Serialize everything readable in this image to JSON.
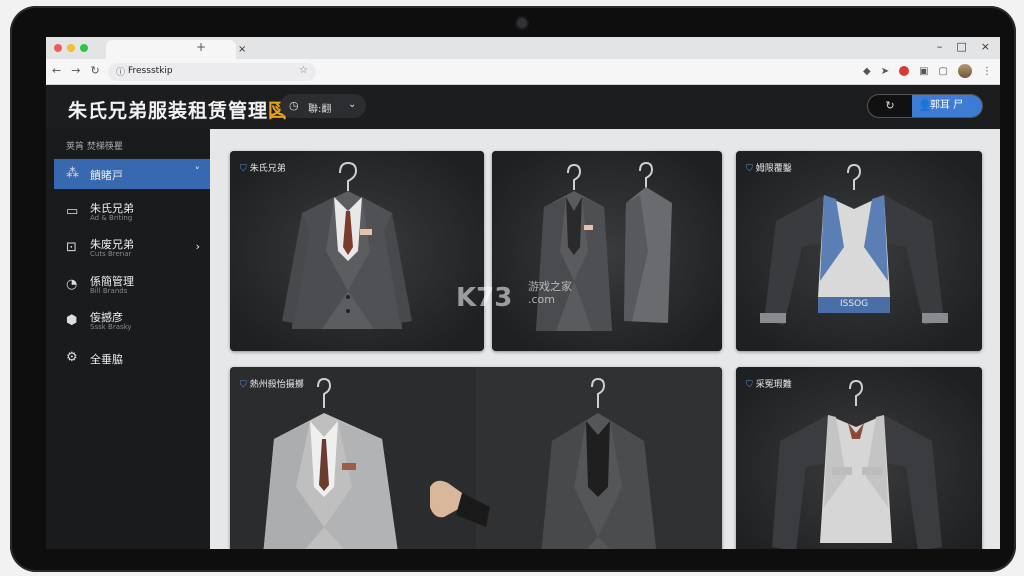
{
  "browser": {
    "url": "Fressstkip",
    "colors": {
      "close": "#ee5f57",
      "min": "#f5bd2f",
      "max": "#2bc840"
    },
    "tab_close": "×",
    "new_tab": "+",
    "win_controls": [
      "–",
      "□",
      "×"
    ],
    "nav": [
      "←",
      "→",
      "↻"
    ]
  },
  "app": {
    "title": "朱氏兄弟服装租赁管理",
    "title_badge": "図",
    "header_pill": {
      "label": "聯:翻",
      "icon": "clock-icon"
    },
    "account_label": "郭耳 尸"
  },
  "sidebar": {
    "breadcrumb": "荚筲   焚梯筷瞿",
    "items": [
      {
        "label": "饋睹戸",
        "sub": "",
        "icon": "hanger-grid-icon",
        "active": true,
        "chevron": "˅"
      },
      {
        "label": "朱氏兄弟",
        "sub": "Ad & Briting",
        "icon": "folder-icon",
        "active": false,
        "chevron": ""
      },
      {
        "label": "朱废兄弟",
        "sub": "Cuts Brenar",
        "icon": "scanner-icon",
        "active": false,
        "chevron": "›"
      },
      {
        "label": "係簡管理",
        "sub": "Bill Brands",
        "icon": "clock-icon",
        "active": false,
        "chevron": ""
      },
      {
        "label": "侫撼彦",
        "sub": "Sssk Brasky",
        "icon": "hexagon-icon",
        "active": false,
        "chevron": ""
      },
      {
        "label": "全垂脇",
        "sub": "",
        "icon": "gear-icon",
        "active": false,
        "chevron": ""
      }
    ]
  },
  "cards": [
    {
      "title": "朱氏兄弟",
      "kind": "suit-grey"
    },
    {
      "title": "",
      "kind": "suit-pair"
    },
    {
      "title": "姆限覆鑿",
      "kind": "vest-blue",
      "band": "ISSOG"
    },
    {
      "title": "熱州殺怡摄擲",
      "kind": "suit-light"
    },
    {
      "title": "采冤瑕難",
      "kind": "vest-grey"
    }
  ],
  "watermark": {
    "brand": "K73",
    "site": "游戏之家",
    "domain": ".com"
  }
}
